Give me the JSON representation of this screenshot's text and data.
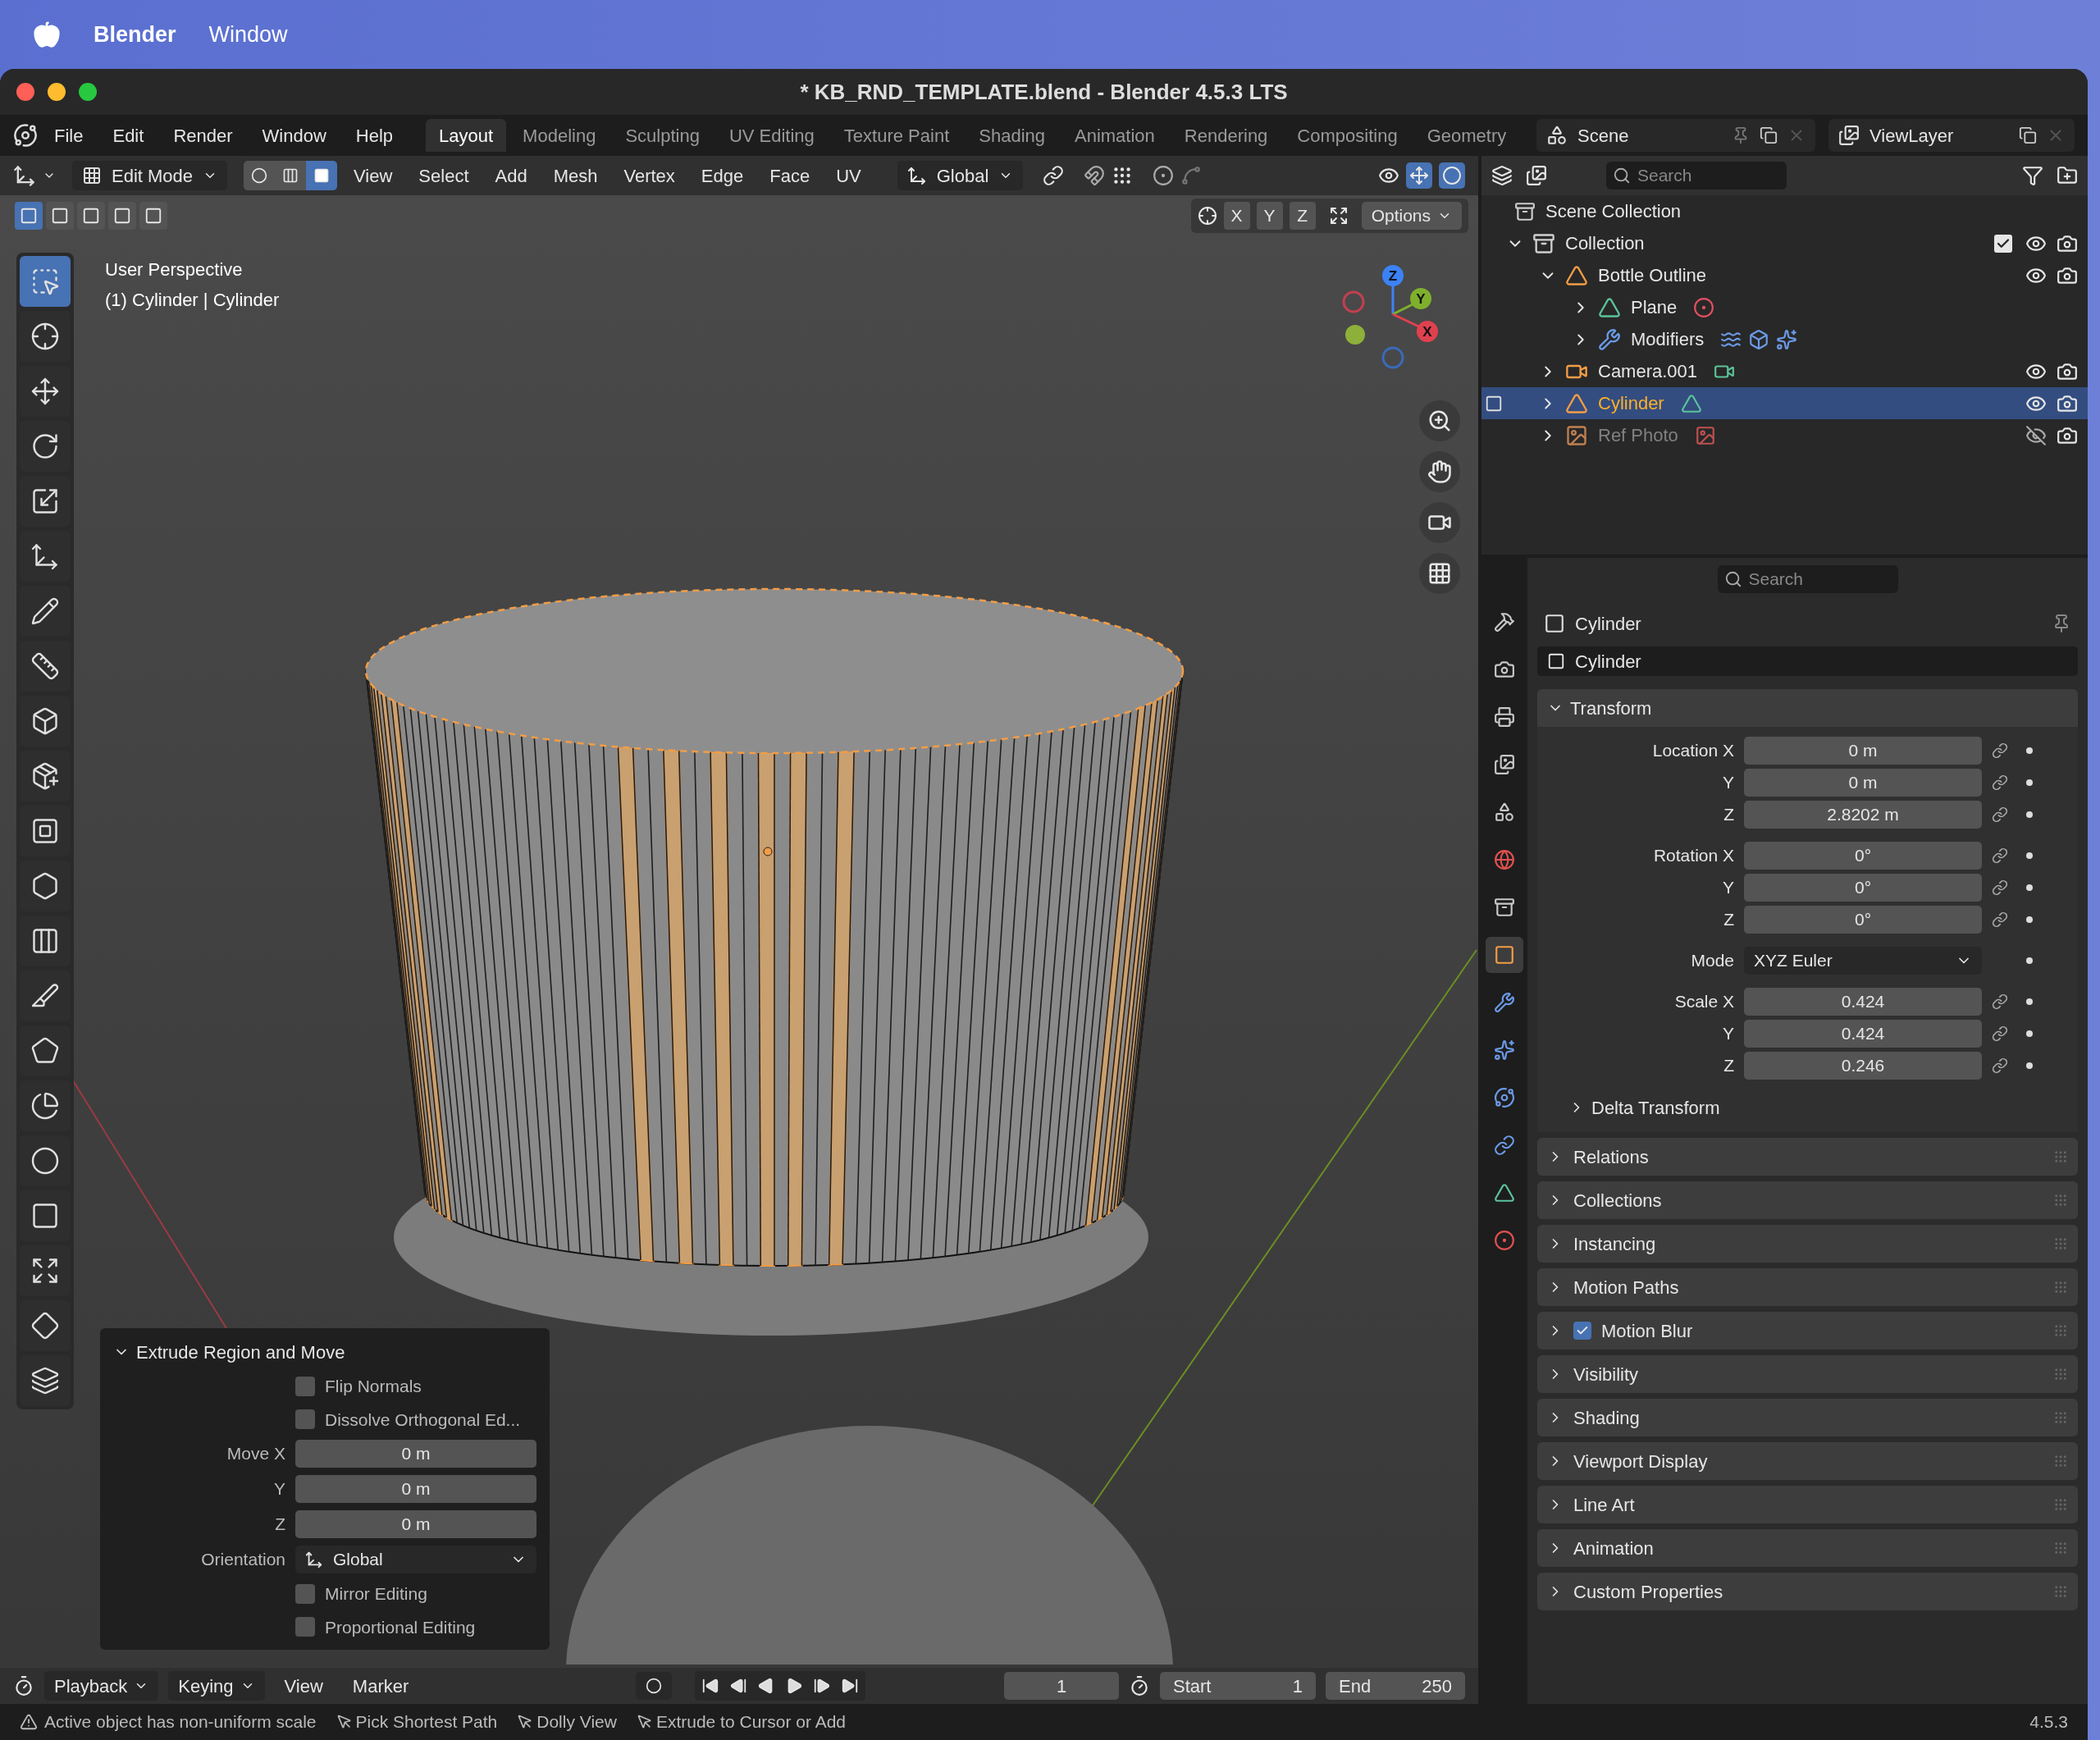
{
  "os_menubar": {
    "app": "Blender",
    "items": [
      "Window"
    ]
  },
  "window": {
    "title": "* KB_RND_TEMPLATE.blend - Blender 4.5.3 LTS"
  },
  "menu": [
    "File",
    "Edit",
    "Render",
    "Window",
    "Help"
  ],
  "workspaces": [
    {
      "label": "Layout",
      "selected": true
    },
    {
      "label": "Modeling",
      "selected": false
    },
    {
      "label": "Sculpting",
      "selected": false
    },
    {
      "label": "UV Editing",
      "selected": false
    },
    {
      "label": "Texture Paint",
      "selected": false
    },
    {
      "label": "Shading",
      "selected": false
    },
    {
      "label": "Animation",
      "selected": false
    },
    {
      "label": "Rendering",
      "selected": false
    },
    {
      "label": "Compositing",
      "selected": false
    },
    {
      "label": "Geometry",
      "selected": false
    }
  ],
  "scene": "Scene",
  "view_layer": "ViewLayer",
  "viewport_header": {
    "mode": "Edit Mode",
    "select_modes": [
      {
        "kind": "vertex",
        "selected": false
      },
      {
        "kind": "edge",
        "selected": false
      },
      {
        "kind": "face",
        "selected": true
      }
    ],
    "menus": [
      "View",
      "Select",
      "Add",
      "Mesh",
      "Vertex",
      "Edge",
      "Face",
      "UV"
    ],
    "orientation": "Global",
    "axes": [
      "X",
      "Y",
      "Z"
    ],
    "options": "Options"
  },
  "viewport": {
    "view_name": "User Perspective",
    "object_info": "(1) Cylinder | Cylinder",
    "gizmo_axes": [
      "Z",
      "Y",
      "X"
    ]
  },
  "tools": [
    {
      "kind": "select",
      "selected": true
    },
    {
      "kind": "cursor",
      "selected": false
    },
    {
      "kind": "move",
      "selected": false
    },
    {
      "kind": "rotate",
      "selected": false
    },
    {
      "kind": "scale",
      "selected": false
    },
    {
      "kind": "transform",
      "selected": false
    },
    {
      "kind": "annotate",
      "selected": false
    },
    {
      "kind": "measure",
      "selected": false
    },
    {
      "kind": "add_cube",
      "selected": false
    },
    {
      "kind": "extrude",
      "selected": false
    },
    {
      "kind": "inset",
      "selected": false
    },
    {
      "kind": "bevel",
      "selected": false
    },
    {
      "kind": "loop_cut",
      "selected": false
    },
    {
      "kind": "knife",
      "selected": false
    },
    {
      "kind": "poly_build",
      "selected": false
    },
    {
      "kind": "spin",
      "selected": false
    },
    {
      "kind": "smooth",
      "selected": false
    },
    {
      "kind": "edge_slide",
      "selected": false
    },
    {
      "kind": "shrink",
      "selected": false
    },
    {
      "kind": "shear",
      "selected": false
    },
    {
      "kind": "rip",
      "selected": false
    }
  ],
  "operator_panel": {
    "title": "Extrude Region and Move",
    "expanded": true,
    "fields": [
      {
        "kind": "checkbox",
        "label": "Flip Normals",
        "checked": false
      },
      {
        "kind": "checkbox",
        "label": "Dissolve Orthogonal Ed...",
        "checked": false
      },
      {
        "kind": "number",
        "label": "Move X",
        "value": "0 m"
      },
      {
        "kind": "number",
        "label": "Y",
        "value": "0 m"
      },
      {
        "kind": "number",
        "label": "Z",
        "value": "0 m"
      },
      {
        "kind": "dropdown",
        "label": "Orientation",
        "value": "Global"
      },
      {
        "kind": "checkbox",
        "label": "Mirror Editing",
        "checked": false
      },
      {
        "kind": "checkbox",
        "label": "Proportional Editing",
        "checked": false
      }
    ]
  },
  "outliner": {
    "search": {
      "placeholder": "Search"
    },
    "root": {
      "label": "Scene Collection",
      "children": [
        {
          "label": "Collection",
          "kind": "collection",
          "expanded": true,
          "selected": false,
          "included": true,
          "visible": true,
          "children": [
            {
              "label": "Bottle Outline",
              "kind": "mesh_object",
              "expanded": true,
              "selected": false,
              "visible": true,
              "children": [
                {
                  "label": "Plane",
                  "kind": "mesh_data",
                  "expanded": false,
                  "selected": false
                },
                {
                  "label": "Modifiers",
                  "kind": "modifiers",
                  "expanded": false,
                  "selected": false
                }
              ]
            },
            {
              "label": "Camera.001",
              "kind": "camera",
              "expanded": false,
              "selected": false,
              "visible": true
            },
            {
              "label": "Cylinder",
              "kind": "mesh_object",
              "expanded": false,
              "selected": true,
              "visible": true
            },
            {
              "label": "Ref Photo",
              "kind": "image",
              "expanded": false,
              "selected": false,
              "visible": false
            }
          ]
        }
      ]
    }
  },
  "properties": {
    "search": {
      "placeholder": "Search"
    },
    "tabs": [
      {
        "kind": "tool",
        "selected": false
      },
      {
        "kind": "render",
        "selected": false
      },
      {
        "kind": "output",
        "selected": false
      },
      {
        "kind": "view_layer",
        "selected": false
      },
      {
        "kind": "scene",
        "selected": false
      },
      {
        "kind": "world",
        "selected": false
      },
      {
        "kind": "collection",
        "selected": false
      },
      {
        "kind": "object",
        "selected": true
      },
      {
        "kind": "modifiers",
        "selected": false
      },
      {
        "kind": "particles",
        "selected": false
      },
      {
        "kind": "physics",
        "selected": false
      },
      {
        "kind": "constraints",
        "selected": false
      },
      {
        "kind": "data",
        "selected": false
      },
      {
        "kind": "material",
        "selected": false
      }
    ],
    "object_name": "Cylinder",
    "name_field": "Cylinder",
    "transform": {
      "title": "Transform",
      "expanded": true,
      "groups": [
        {
          "rows": [
            {
              "label": "Location X",
              "value": "0 m",
              "kind": "number"
            },
            {
              "label": "Y",
              "value": "0 m",
              "kind": "number"
            },
            {
              "label": "Z",
              "value": "2.8202 m",
              "kind": "number"
            }
          ]
        },
        {
          "rows": [
            {
              "label": "Rotation X",
              "value": "0°",
              "kind": "number"
            },
            {
              "label": "Y",
              "value": "0°",
              "kind": "number"
            },
            {
              "label": "Z",
              "value": "0°",
              "kind": "number"
            }
          ]
        },
        {
          "rows": [
            {
              "label": "Mode",
              "value": "XYZ Euler",
              "kind": "dropdown"
            }
          ]
        },
        {
          "rows": [
            {
              "label": "Scale X",
              "value": "0.424",
              "kind": "number"
            },
            {
              "label": "Y",
              "value": "0.424",
              "kind": "number"
            },
            {
              "label": "Z",
              "value": "0.246",
              "kind": "number"
            }
          ]
        }
      ],
      "subsection": {
        "label": "Delta Transform",
        "expanded": false
      }
    },
    "sections": [
      {
        "label": "Relations",
        "kind": "plain",
        "expanded": false
      },
      {
        "label": "Collections",
        "kind": "plain",
        "expanded": false
      },
      {
        "label": "Instancing",
        "kind": "plain",
        "expanded": false
      },
      {
        "label": "Motion Paths",
        "kind": "plain",
        "expanded": false
      },
      {
        "label": "Motion Blur",
        "kind": "checkbox",
        "checked": true,
        "expanded": false
      },
      {
        "label": "Visibility",
        "kind": "plain",
        "expanded": false
      },
      {
        "label": "Shading",
        "kind": "plain",
        "expanded": false
      },
      {
        "label": "Viewport Display",
        "kind": "plain",
        "expanded": false
      },
      {
        "label": "Line Art",
        "kind": "plain",
        "expanded": false
      },
      {
        "label": "Animation",
        "kind": "plain",
        "expanded": false
      },
      {
        "label": "Custom Properties",
        "kind": "plain",
        "expanded": false
      }
    ]
  },
  "timeline": {
    "menus": [
      {
        "label": "Playback",
        "dropdown": true
      },
      {
        "label": "Keying",
        "dropdown": true
      },
      {
        "label": "View",
        "dropdown": false
      },
      {
        "label": "Marker",
        "dropdown": false
      }
    ],
    "current_frame": "1",
    "start_label": "Start",
    "start": "1",
    "end_label": "End",
    "end": "250"
  },
  "status_bar": {
    "warning": "Active object has non-uniform scale",
    "hints": [
      "Pick Shortest Path",
      "Dolly View",
      "Extrude to Cursor or Add"
    ],
    "version": "4.5.3"
  }
}
